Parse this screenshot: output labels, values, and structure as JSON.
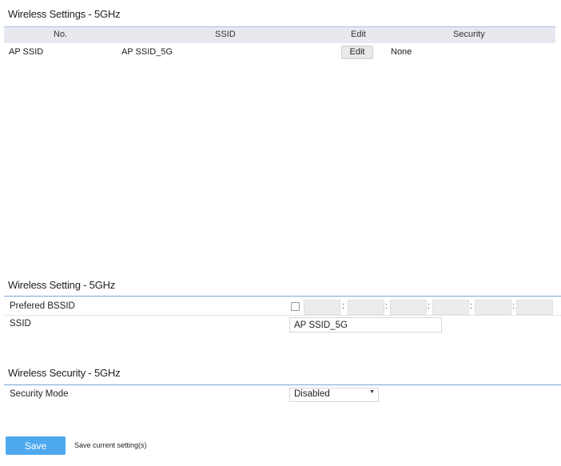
{
  "ap_table": {
    "title": "Wireless Settings - 5GHz",
    "headers": {
      "no": "No.",
      "ssid": "SSID",
      "edit": "Edit",
      "security": "Security"
    },
    "rows": [
      {
        "no": "AP SSID",
        "ssid": "AP SSID_5G",
        "edit_label": "Edit",
        "security": "None"
      }
    ]
  },
  "wireless_setting": {
    "title": "Wireless Setting - 5GHz",
    "preferred_bssid_label": "Prefered BSSID",
    "preferred_bssid_checked": false,
    "octet_separator": ":",
    "ssid_label": "SSID",
    "ssid_value": "AP SSID_5G"
  },
  "wireless_security": {
    "title": "Wireless Security - 5GHz",
    "security_mode_label": "Security Mode",
    "security_mode_value": "Disabled"
  },
  "actions": {
    "save_label": "Save",
    "save_description": "Save current setting(s)"
  },
  "colors": {
    "accent_rule": "#7aa6d6",
    "save_button": "#4fa9ef",
    "table_header_bg": "#e7e9ee"
  },
  "icons": {
    "select_caret": "chevron-down-icon"
  }
}
